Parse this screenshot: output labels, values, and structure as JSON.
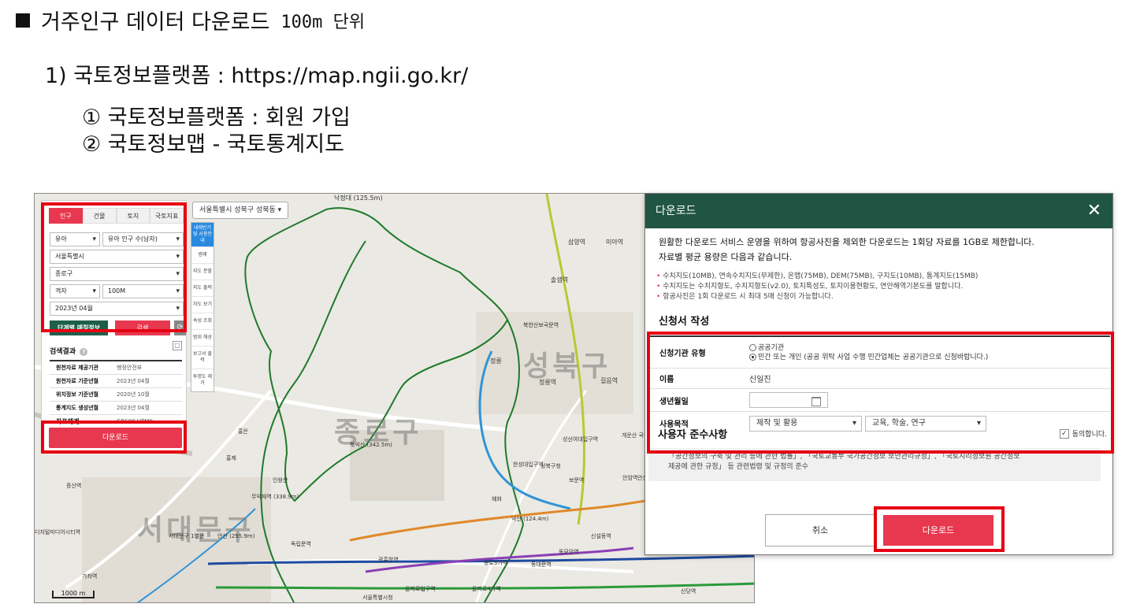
{
  "doc": {
    "heading_text": "거주인구 데이터 다운로드",
    "heading_unit": "100m 단위",
    "sub1": "1) 국토정보플랫폼 : https://map.ngii.go.kr/",
    "step1": "① 국토정보플랫폼 : 회원 가입",
    "step2": "② 국토정보맵 - 국토통계지도"
  },
  "map": {
    "location_select": "서울특별시 성북구 성북동",
    "tools": [
      "내래반기 및 사용안내",
      "범례",
      "지도 분할",
      "지도 출력",
      "자도 보기",
      "속성 조회",
      "범위 해상",
      "보고서 출력",
      "투명도 제거"
    ],
    "scale": "1000 m",
    "big_labels": [
      "종로구",
      "성북구",
      "서대문구"
    ],
    "labels": [
      "낙정대 (125.5m)",
      "삼양역",
      "미아역",
      "솔샘역",
      "북한산보국문역",
      "정릉",
      "정릉역",
      "길음역",
      "성신여대입구역",
      "한성대입구역",
      "성북구청",
      "보문역",
      "안암역",
      "북악산 (342.5m)",
      "무악재역 (338.9m)",
      "인왕산",
      "독립문역",
      "홍은",
      "홍제",
      "증산역",
      "디지털미디어시티역",
      "서대문구 1별관",
      "안산 (295.9m)",
      "가좌역",
      "광흥창역",
      "종로3가역",
      "혜화",
      "낙산 (124.4m)",
      "신설동역",
      "동묘앞역",
      "동대문역",
      "을지로입구역",
      "을지로4가역",
      "서울특별시청",
      "개운산 국립공원",
      "안산역",
      "신당역"
    ]
  },
  "panel": {
    "tabs": [
      "인구",
      "건물",
      "토지",
      "국토지표"
    ],
    "selects": {
      "category": "유아",
      "indicator": "유아 인구 수(남자)",
      "sido": "서울특별시",
      "sigungu": "종로구",
      "grid": "격자",
      "grid_size": "100M",
      "period": "2023년 04월"
    },
    "btn_stage": "단계별 매칭정보",
    "btn_search": "검색",
    "btn_reset": "⟳",
    "result_title": "검색결과",
    "result_rows": [
      {
        "k": "원천자료 제공기관",
        "v": "행정안전부"
      },
      {
        "k": "원천자료 기준년월",
        "v": "2023년 04월"
      },
      {
        "k": "위치정보 기준년월",
        "v": "2020년 10월"
      },
      {
        "k": "통계지도 생성년월",
        "v": "2023년 04월"
      },
      {
        "k": "좌표체계",
        "v": "GRS80 UTMK"
      }
    ],
    "download": "다운로드"
  },
  "dialog": {
    "title": "다운로드",
    "intro1": "원활한 다운로드 서비스 운영을 위하여 항공사진을 제외한 다운로드는 1회당 자료를 1GB로 제한합니다.",
    "intro2": "자료별 평균 용량은 다음과 같습니다.",
    "notes": [
      "수치지도(10MB), 연속수치지도(무제한), 온맵(75MB), DEM(75MB), 구지도(10MB), 통계지도(15MB)",
      "수치지도는 수치지형도, 수치지형도(v2.0), 토지특성도, 토지이용현황도, 연안해역기본도를 말합니다.",
      "항공사진은 1회 다운로드 시 최대 5매 신청이 가능합니다."
    ],
    "section": "신청서 작성",
    "f_org_label": "신청기관 유형",
    "f_org_opt1": "공공기관",
    "f_org_opt2": "민간 또는 개인 (공공 위탁 사업 수행 민간업체는 공공기관으로 신청바랍니다.)",
    "f_name_label": "이름",
    "f_name_value": "신일진",
    "f_birth_label": "생년월일",
    "f_purpose_label": "사용목적",
    "f_purpose1": "제작 및 활용",
    "f_purpose2": "교육, 학술, 연구",
    "compliance": "사용자 준수사항",
    "agree": "동의합니다.",
    "regs1": "「공간정보의 구축 및 관리 등에 관한 법률」, 「국토교통부 국가공간정보 보안관리규정」, 「국토지리정보원 공간정보",
    "regs2": "제공에 관한 규정」 등 관련법령 및 규정의 준수",
    "cancel": "취소",
    "download": "다운로드"
  },
  "colors": {
    "accent_red": "#e8384f",
    "header_green": "#215543",
    "highlight": "#e60012"
  }
}
